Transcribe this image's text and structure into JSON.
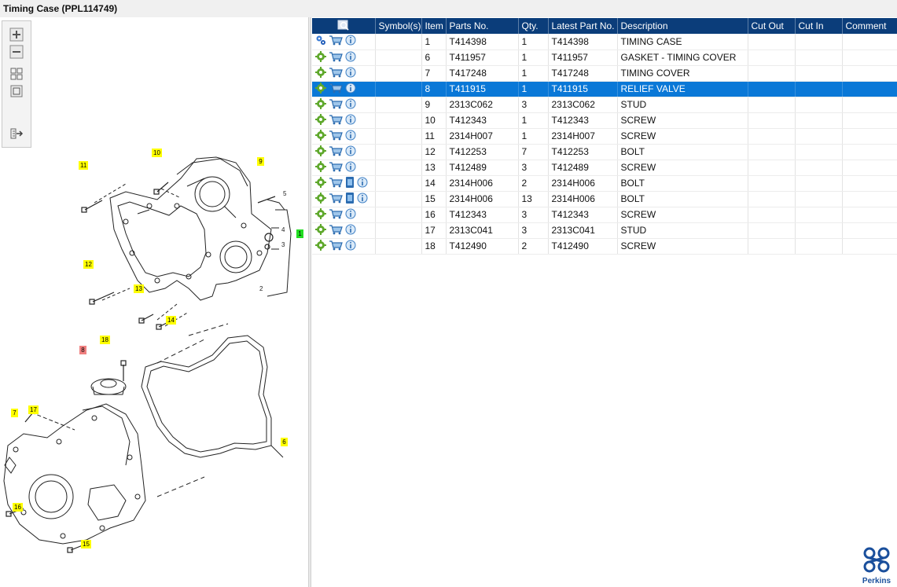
{
  "window": {
    "title": "Timing Case (PPL114749)"
  },
  "toolbar": {
    "zoom_in": "zoom-in-icon",
    "zoom_out": "zoom-out-icon",
    "fit": "fit-all-icon",
    "actual": "actual-size-icon",
    "export": "export-icon"
  },
  "diagram": {
    "callouts": [
      {
        "text": "11",
        "state": "normal"
      },
      {
        "text": "10",
        "state": "normal"
      },
      {
        "text": "9",
        "state": "normal"
      },
      {
        "text": "1",
        "state": "green"
      },
      {
        "text": "12",
        "state": "normal"
      },
      {
        "text": "13",
        "state": "normal"
      },
      {
        "text": "14",
        "state": "normal"
      },
      {
        "text": "18",
        "state": "normal"
      },
      {
        "text": "8",
        "state": "selected"
      },
      {
        "text": "7",
        "state": "normal"
      },
      {
        "text": "17",
        "state": "normal"
      },
      {
        "text": "6",
        "state": "normal"
      },
      {
        "text": "16",
        "state": "normal"
      },
      {
        "text": "15",
        "state": "normal"
      }
    ],
    "plain_labels": [
      "5",
      "4",
      "3",
      "2"
    ]
  },
  "table": {
    "columns": [
      "",
      "Symbol(s)",
      "Item",
      "Parts No.",
      "Qty.",
      "Latest Part No.",
      "Description",
      "Cut Out",
      "Cut In",
      "Comment"
    ],
    "rows": [
      {
        "item": "1",
        "part_no": "T414398",
        "qty": "1",
        "latest": "T414398",
        "description": "TIMING CASE",
        "icons": [
          "assembly-icon",
          "cart-icon",
          "info-icon"
        ],
        "selected": false
      },
      {
        "item": "6",
        "part_no": "T411957",
        "qty": "1",
        "latest": "T411957",
        "description": "GASKET - TIMING COVER",
        "icons": [
          "part-icon",
          "cart-icon",
          "info-icon"
        ],
        "selected": false
      },
      {
        "item": "7",
        "part_no": "T417248",
        "qty": "1",
        "latest": "T417248",
        "description": "TIMING COVER",
        "icons": [
          "part-icon",
          "cart-icon",
          "info-icon"
        ],
        "selected": false
      },
      {
        "item": "8",
        "part_no": "T411915",
        "qty": "1",
        "latest": "T411915",
        "description": "RELIEF VALVE",
        "icons": [
          "part-icon",
          "cart-icon",
          "info-icon"
        ],
        "selected": true
      },
      {
        "item": "9",
        "part_no": "2313C062",
        "qty": "3",
        "latest": "2313C062",
        "description": "STUD",
        "icons": [
          "part-icon",
          "cart-icon",
          "info-icon"
        ],
        "selected": false
      },
      {
        "item": "10",
        "part_no": "T412343",
        "qty": "1",
        "latest": "T412343",
        "description": "SCREW",
        "icons": [
          "part-icon",
          "cart-icon",
          "info-icon"
        ],
        "selected": false
      },
      {
        "item": "11",
        "part_no": "2314H007",
        "qty": "1",
        "latest": "2314H007",
        "description": "SCREW",
        "icons": [
          "part-icon",
          "cart-icon",
          "info-icon"
        ],
        "selected": false
      },
      {
        "item": "12",
        "part_no": "T412253",
        "qty": "7",
        "latest": "T412253",
        "description": "BOLT",
        "icons": [
          "part-icon",
          "cart-icon",
          "info-icon"
        ],
        "selected": false
      },
      {
        "item": "13",
        "part_no": "T412489",
        "qty": "3",
        "latest": "T412489",
        "description": "SCREW",
        "icons": [
          "part-icon",
          "cart-icon",
          "info-icon"
        ],
        "selected": false
      },
      {
        "item": "14",
        "part_no": "2314H006",
        "qty": "2",
        "latest": "2314H006",
        "description": "BOLT",
        "icons": [
          "part-icon",
          "cart-icon",
          "document-icon",
          "info-icon"
        ],
        "selected": false
      },
      {
        "item": "15",
        "part_no": "2314H006",
        "qty": "13",
        "latest": "2314H006",
        "description": "BOLT",
        "icons": [
          "part-icon",
          "cart-icon",
          "document-icon",
          "info-icon"
        ],
        "selected": false
      },
      {
        "item": "16",
        "part_no": "T412343",
        "qty": "3",
        "latest": "T412343",
        "description": "SCREW",
        "icons": [
          "part-icon",
          "cart-icon",
          "info-icon"
        ],
        "selected": false
      },
      {
        "item": "17",
        "part_no": "2313C041",
        "qty": "3",
        "latest": "2313C041",
        "description": "STUD",
        "icons": [
          "part-icon",
          "cart-icon",
          "info-icon"
        ],
        "selected": false
      },
      {
        "item": "18",
        "part_no": "T412490",
        "qty": "2",
        "latest": "T412490",
        "description": "SCREW",
        "icons": [
          "part-icon",
          "cart-icon",
          "info-icon"
        ],
        "selected": false
      }
    ]
  },
  "brand": {
    "logo_text": "Perkins",
    "color": "#1a4f9c"
  },
  "colors": {
    "header": "#0b3d7a",
    "selection": "#0a78d7",
    "callout": "#ffff00",
    "callout_selected": "#f08080"
  }
}
